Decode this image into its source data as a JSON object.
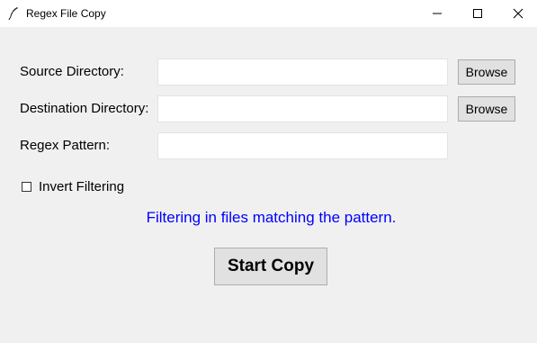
{
  "window": {
    "title": "Regex File Copy"
  },
  "form": {
    "source_label": "Source Directory:",
    "source_value": "",
    "destination_label": "Destination Directory:",
    "destination_value": "",
    "regex_label": "Regex Pattern:",
    "regex_value": "",
    "browse_label": "Browse",
    "invert_label": "Invert Filtering",
    "invert_checked": false
  },
  "status": {
    "text": "Filtering in files matching the pattern.",
    "color": "#0000ff"
  },
  "actions": {
    "start_label": "Start Copy"
  },
  "icons": {
    "app": "feather-icon",
    "minimize": "minimize-icon",
    "maximize": "maximize-icon",
    "close": "close-icon"
  }
}
